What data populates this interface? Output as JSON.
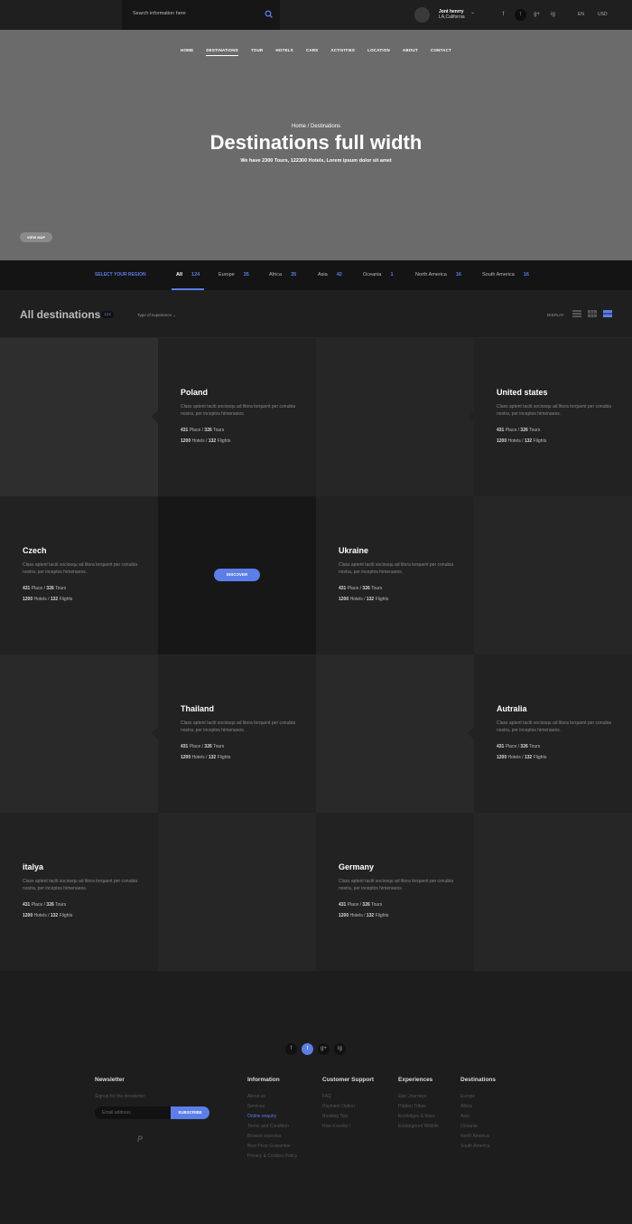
{
  "search": {
    "placeholder": "Search information here"
  },
  "user": {
    "name": "Jont henrry",
    "location": "LA,California"
  },
  "social_top": [
    "f",
    "t",
    "g+",
    "ig"
  ],
  "lang": {
    "language": "EN",
    "currency": "USD"
  },
  "nav": [
    "HOME",
    "DESTINATIONS",
    "TOUR",
    "HOTELS",
    "CARS",
    "ACTIVITIES",
    "LOCATION",
    "ABOUT",
    "CONTACT"
  ],
  "hero": {
    "breadcrumb": "Home /  Destinations",
    "title": "Destinations full width",
    "subtitle": "We have 2300 Tours,  122300 Hotels, Lorem ipsum dolor sit amet",
    "view_map": "VIEW MAP"
  },
  "regions": {
    "label": "SELECT YOUR REGION",
    "tabs": [
      {
        "name": "All",
        "count": "124"
      },
      {
        "name": "Europe",
        "count": "35"
      },
      {
        "name": "Africa",
        "count": "35"
      },
      {
        "name": "Asia",
        "count": "42"
      },
      {
        "name": "Oceania",
        "count": "1"
      },
      {
        "name": "North America",
        "count": "16"
      },
      {
        "name": "South America",
        "count": "16"
      }
    ]
  },
  "destinations_bar": {
    "title": "All destinations",
    "count": "124",
    "type_select": "Type of experience",
    "display_label": "DISPLAY"
  },
  "desc_text": "Class aptent taciti sociosqu ad litora torquent per conubia nostra, per inceptos himenaeos.",
  "stats": {
    "places": "431",
    "place_label": "Place",
    "tours": "326",
    "tours_label": "Tours",
    "hotels": "1200",
    "hotels_label": "Hotels",
    "flights": "132",
    "flights_label": "Flights"
  },
  "destinations": [
    "Poland",
    "United states",
    "Czech",
    "Ukraine",
    "Thailand",
    "Autralia",
    "italya",
    "Germany"
  ],
  "discover_label": "DISCOVER",
  "footer": {
    "newsletter": {
      "heading": "Newsletter",
      "sub": "Signup for the newsletter",
      "placeholder": "Email address",
      "button": "SUBSCRIBE",
      "paypal": "P"
    },
    "information": {
      "heading": "Information",
      "items": [
        "About us",
        "Services",
        "Online enquiry",
        "Terms and Condition",
        "Browse expertes",
        "Best Price Guarantee",
        "Privacy & Cookies Policy"
      ]
    },
    "support": {
      "heading": "Customer Support",
      "items": [
        "FAQ",
        "Payment Option",
        "Booking Tips",
        "How it works !"
      ]
    },
    "experiences": {
      "heading": "Experiences",
      "items": [
        "Epic Journeys",
        "Hidden Tribes",
        "Ecolodges & tours",
        "Endangered Wildlife"
      ]
    },
    "destinations": {
      "heading": "Destinations",
      "items": [
        "Europe",
        "Africa",
        "Asia",
        "Oceania",
        "North America",
        "South America"
      ]
    }
  },
  "colors": {
    "accent": "#5b7ee8",
    "background": "#1d1d1d"
  }
}
